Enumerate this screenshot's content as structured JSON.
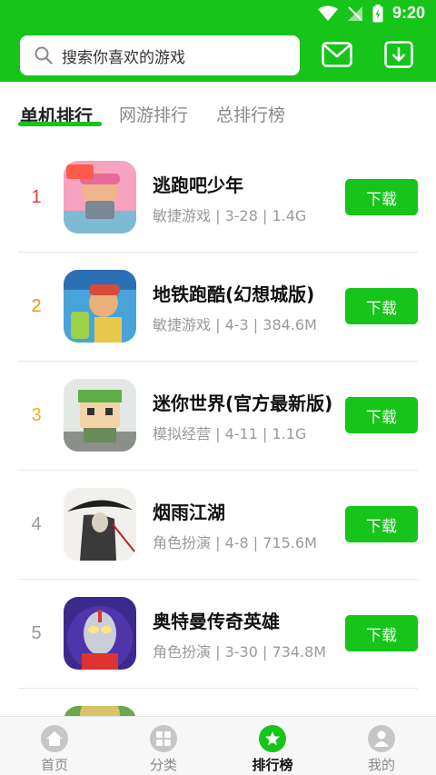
{
  "status_bar": {
    "time": "9:20"
  },
  "search": {
    "placeholder": "搜索你喜欢的游戏"
  },
  "tabs": [
    {
      "label": "单机排行",
      "active": true
    },
    {
      "label": "网游排行",
      "active": false
    },
    {
      "label": "总排行榜",
      "active": false
    }
  ],
  "apps": [
    {
      "rank": "1",
      "name": "逃跑吧少年",
      "meta": "敏捷游戏 | 3-28 | 1.4G",
      "button": "下载",
      "rank_color": "#e53935"
    },
    {
      "rank": "2",
      "name": "地铁跑酷(幻想城版)",
      "meta": "敏捷游戏 | 4-3 | 384.6M",
      "button": "下载",
      "rank_color": "#f08c1a"
    },
    {
      "rank": "3",
      "name": "迷你世界(官方最新版)",
      "meta": "模拟经营 | 4-11 | 1.1G",
      "button": "下载",
      "rank_color": "#f2b21b"
    },
    {
      "rank": "4",
      "name": "烟雨江湖",
      "meta": "角色扮演 | 4-8 | 715.6M",
      "button": "下载",
      "rank_color": "#999999"
    },
    {
      "rank": "5",
      "name": "奥特曼传奇英雄",
      "meta": "角色扮演 | 3-30 | 734.8M",
      "button": "下载",
      "rank_color": "#999999"
    }
  ],
  "bottom_nav": [
    {
      "label": "首页",
      "icon": "home-icon",
      "active": false
    },
    {
      "label": "分类",
      "icon": "grid-icon",
      "active": false
    },
    {
      "label": "排行榜",
      "icon": "star-badge-icon",
      "active": true
    },
    {
      "label": "我的",
      "icon": "person-icon",
      "active": false
    }
  ],
  "colors": {
    "accent": "#16c41a"
  }
}
